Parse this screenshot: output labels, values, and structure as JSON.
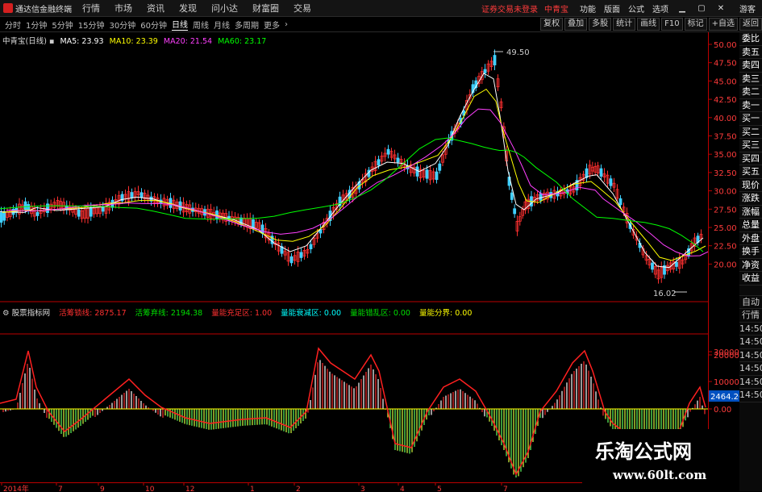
{
  "app": {
    "title": "通达信金融终端",
    "login_status": "证券交易未登录",
    "stock_short": "中青宝",
    "guest": "游客"
  },
  "menu": [
    "行情",
    "市场",
    "资讯",
    "发现",
    "问小达",
    "财富圈",
    "交易"
  ],
  "right_menu": [
    "功能",
    "版面",
    "公式",
    "选项"
  ],
  "periods": [
    "分时",
    "1分钟",
    "5分钟",
    "15分钟",
    "30分钟",
    "60分钟",
    "日线",
    "周线",
    "月线",
    "多周期",
    "更多"
  ],
  "active_period": "日线",
  "tools": [
    "复权",
    "叠加",
    "多股",
    "统计",
    "画线",
    "F10",
    "标记",
    "+自选",
    "返回"
  ],
  "main": {
    "title": "中青宝(日线)",
    "ma": [
      {
        "label": "MA5: 23.93",
        "color": "#ffffff"
      },
      {
        "label": "MA10: 23.39",
        "color": "#ffff00"
      },
      {
        "label": "MA20: 21.54",
        "color": "#ff40ff"
      },
      {
        "label": "MA60: 23.17",
        "color": "#00ff00"
      }
    ],
    "high_label": "49.50",
    "low_label": "16.02",
    "price_ticks": [
      "50.00",
      "47.50",
      "45.00",
      "42.50",
      "40.00",
      "37.50",
      "35.00",
      "32.50",
      "30.00",
      "27.50",
      "25.00",
      "22.50",
      "20.00"
    ]
  },
  "sub": {
    "title": "股票指标网",
    "items": [
      {
        "name": "活筹锁线:",
        "value": "2875.17",
        "name_color": "#ff3030",
        "value_color": "#ff3030"
      },
      {
        "name": "活筹弃线:",
        "value": "2194.38",
        "name_color": "#00e000",
        "value_color": "#00e000"
      },
      {
        "name": "量能充足区:",
        "value": "1.00",
        "name_color": "#ff3030",
        "value_color": "#ff3030"
      },
      {
        "name": "量能衰减区:",
        "value": "0.00",
        "name_color": "#00ffff",
        "value_color": "#00ffff"
      },
      {
        "name": "量能错乱区:",
        "value": "0.00",
        "name_color": "#00e000",
        "value_color": "#00e000"
      },
      {
        "name": "量能分界:",
        "value": "0.00",
        "name_color": "#ffff00",
        "value_color": "#ffff00"
      }
    ],
    "ticks": [
      "30000",
      "20000",
      "10000",
      "0.00"
    ],
    "current_value": "2464.26"
  },
  "side_tabs_top": [
    "委比",
    "卖五",
    "卖四",
    "卖三",
    "卖二",
    "卖一",
    "买一",
    "买二",
    "买三",
    "买四",
    "买五",
    "现价",
    "涨跌",
    "涨幅",
    "总量",
    "外盘",
    "换手",
    "净资",
    "收益"
  ],
  "side_tabs_bottom": [
    "自动",
    "行情",
    "14:50",
    "14:50",
    "14:50",
    "14:50",
    "14:50",
    "14:50"
  ],
  "date_ticks": [
    "2014年",
    "7",
    "9",
    "10",
    "12",
    "1",
    "2",
    "3",
    "4",
    "5",
    "7"
  ],
  "watermark": {
    "line1": "乐淘公式网",
    "line2": "www.60lt.com"
  }
}
